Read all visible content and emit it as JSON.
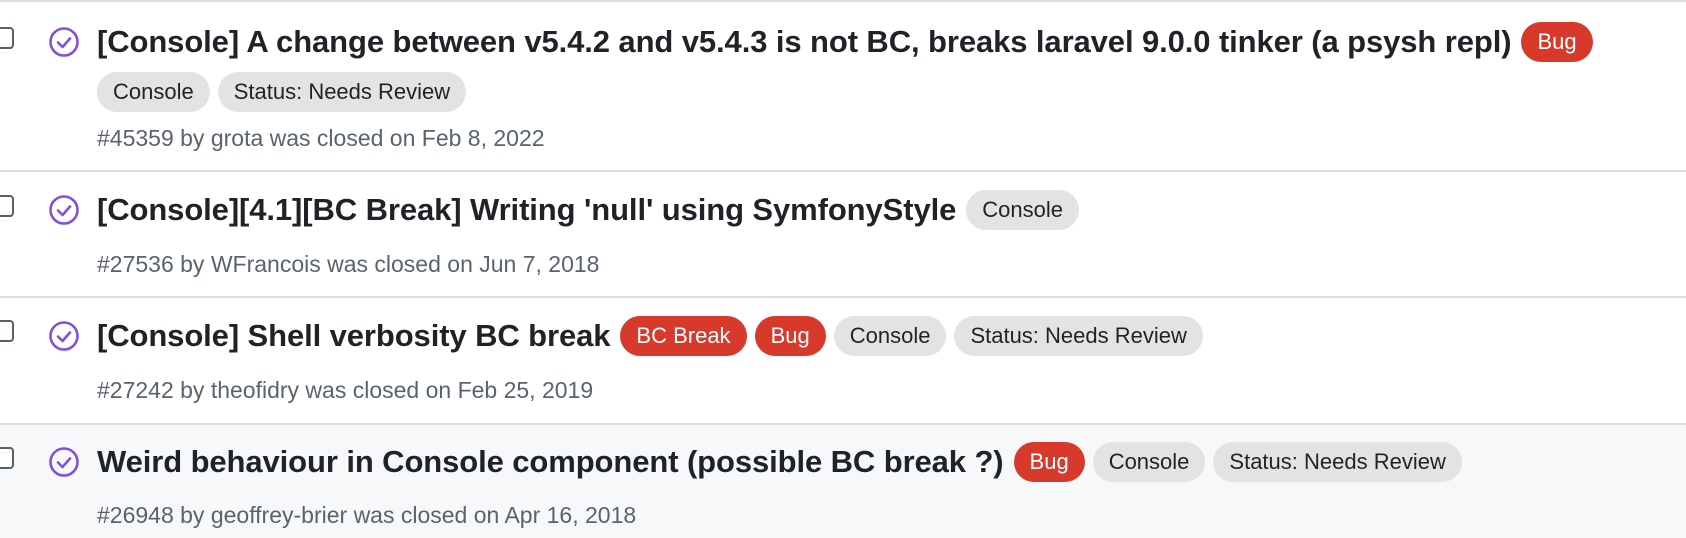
{
  "accent_colors": {
    "closed_icon": "#8250df",
    "label_red": "#d73a2b",
    "label_grey": "#e3e3e4",
    "meta_text": "#59636e"
  },
  "state_icon": "check-circle-icon",
  "issues": [
    {
      "title": "[Console] A change between v5.4.2 and v5.4.3 is not BC, breaks laravel 9.0.0 tinker (a psysh repl)",
      "labels": [
        "Bug",
        "Console",
        "Status: Needs Review"
      ],
      "meta": "#45359 by grota was closed on Feb 8, 2022"
    },
    {
      "title": "[Console][4.1][BC Break] Writing 'null' using SymfonyStyle",
      "labels": [
        "Console"
      ],
      "meta": "#27536 by WFrancois was closed on Jun 7, 2018"
    },
    {
      "title": "[Console] Shell verbosity BC break",
      "labels": [
        "BC Break",
        "Bug",
        "Console",
        "Status: Needs Review"
      ],
      "meta": "#27242 by theofidry was closed on Feb 25, 2019"
    },
    {
      "title": "Weird behaviour in Console component (possible BC break ?)",
      "labels": [
        "Bug",
        "Console",
        "Status: Needs Review"
      ],
      "meta": "#26948 by geoffrey-brier was closed on Apr 16, 2018"
    }
  ]
}
